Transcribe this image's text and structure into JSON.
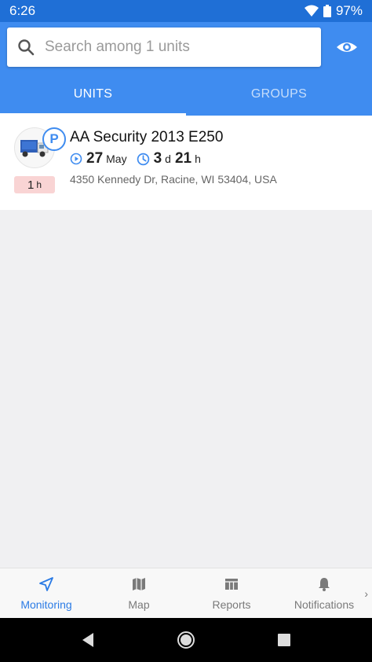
{
  "status_bar": {
    "time": "6:26",
    "battery": "97%"
  },
  "search": {
    "placeholder": "Search among 1 units",
    "value": ""
  },
  "tabs": [
    {
      "label": "UNITS",
      "active": true
    },
    {
      "label": "GROUPS",
      "active": false
    }
  ],
  "unit": {
    "name": "AA Security 2013 E250",
    "parking_badge": "P",
    "duration_value": "1",
    "duration_unit": "h",
    "date_day": "27",
    "date_month": "May",
    "elapsed_days": "3",
    "elapsed_days_unit": "d",
    "elapsed_hours": "21",
    "elapsed_hours_unit": "h",
    "address": "4350 Kennedy Dr, Racine, WI 53404, USA"
  },
  "bottom_nav": [
    {
      "label": "Monitoring",
      "icon": "navigation-arrow-icon",
      "active": true
    },
    {
      "label": "Map",
      "icon": "map-icon",
      "active": false
    },
    {
      "label": "Reports",
      "icon": "reports-icon",
      "active": false
    },
    {
      "label": "Notifications",
      "icon": "bell-icon",
      "active": false
    }
  ],
  "colors": {
    "primary": "#3f8cf0",
    "status_bar": "#1f6fd6",
    "duration_badge": "#f9d4d4"
  }
}
